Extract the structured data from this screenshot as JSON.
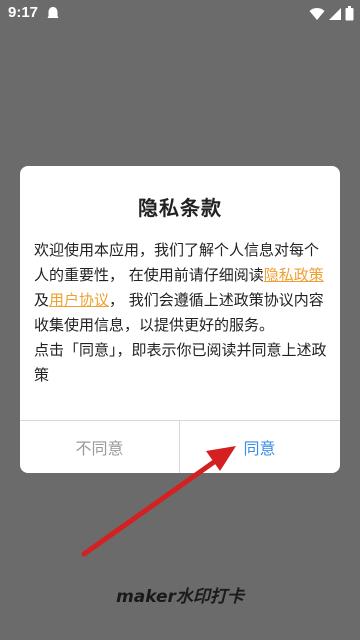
{
  "status_bar": {
    "time": "9:17",
    "icons": [
      "notification-icon",
      "wifi-icon",
      "signal-icon",
      "battery-icon"
    ]
  },
  "dialog": {
    "title": "隐私条款",
    "body": {
      "p1_before": "欢迎使用本应用，我们了解个人信息对每个人的重要性， 在使用前请仔细阅读",
      "link_privacy": "隐私政策",
      "and": "及",
      "link_user": "用户协议",
      "p1_after": "， 我们会遵循上述政策协议内容收集使用信息，以提供更好的服务。",
      "p2": "点击「同意」，即表示你已阅读并同意上述政策"
    },
    "buttons": {
      "disagree": "不同意",
      "agree": "同意"
    }
  },
  "watermark": "maker水印打卡",
  "colors": {
    "overlay": "#6b6b6b",
    "link": "#f0a030",
    "agree": "#3a8ee6",
    "arrow": "#d42020"
  }
}
